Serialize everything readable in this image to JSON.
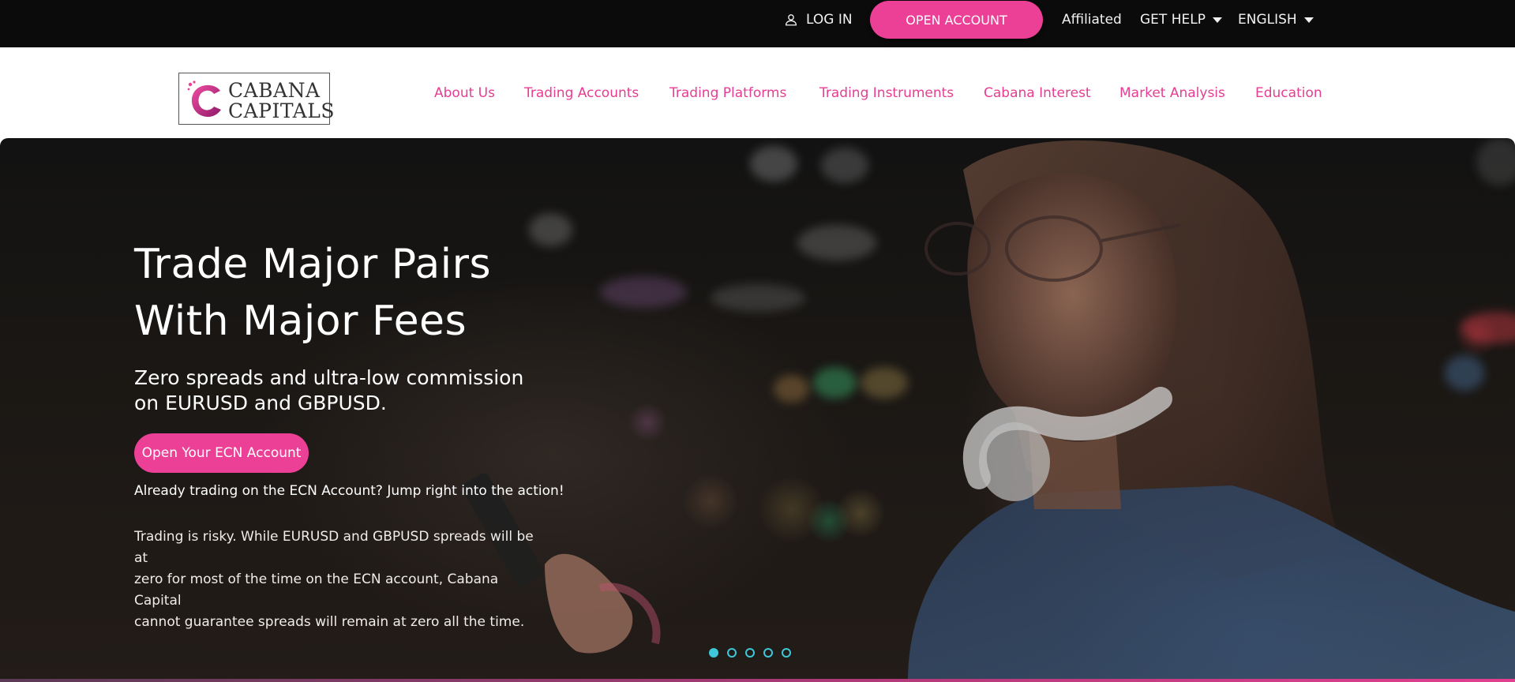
{
  "topbar": {
    "login_label": "LOG IN",
    "open_account_label": "OPEN ACCOUNT",
    "affiliated_label": "Affiliated",
    "get_help_label": "GET HELP",
    "language_label": "ENGLISH"
  },
  "logo": {
    "line1": "CABANA",
    "line2": "CAPITALS"
  },
  "nav": {
    "items": [
      {
        "label": "About Us"
      },
      {
        "label": "Trading Accounts"
      },
      {
        "label": "Trading Platforms"
      },
      {
        "label": "Trading Instruments"
      },
      {
        "label": "Cabana Interest"
      },
      {
        "label": "Market Analysis"
      },
      {
        "label": "Education"
      }
    ]
  },
  "hero": {
    "title_line1": "Trade Major Pairs",
    "title_line2": "With Major Fees",
    "subtitle_line1": "Zero spreads and ultra-low commission",
    "subtitle_line2": "on EURUSD and GBPUSD.",
    "cta_label": "Open Your ECN Account",
    "already_text": "Already trading on the ECN Account? Jump right into the action!",
    "risk_line1": "Trading is risky. While EURUSD and GBPUSD spreads will be at",
    "risk_line2": "zero for most of the time on the ECN account, Cabana Capital",
    "risk_line3": "cannot guarantee spreads will remain at zero all the time."
  },
  "slider": {
    "slide_count": 5,
    "active_index": 0
  },
  "colors": {
    "brand_pink": "#ec3f96",
    "nav_link": "#e63d92",
    "topbar_bg": "#0b0b0b",
    "slider_dot": "#3ec7d9"
  }
}
